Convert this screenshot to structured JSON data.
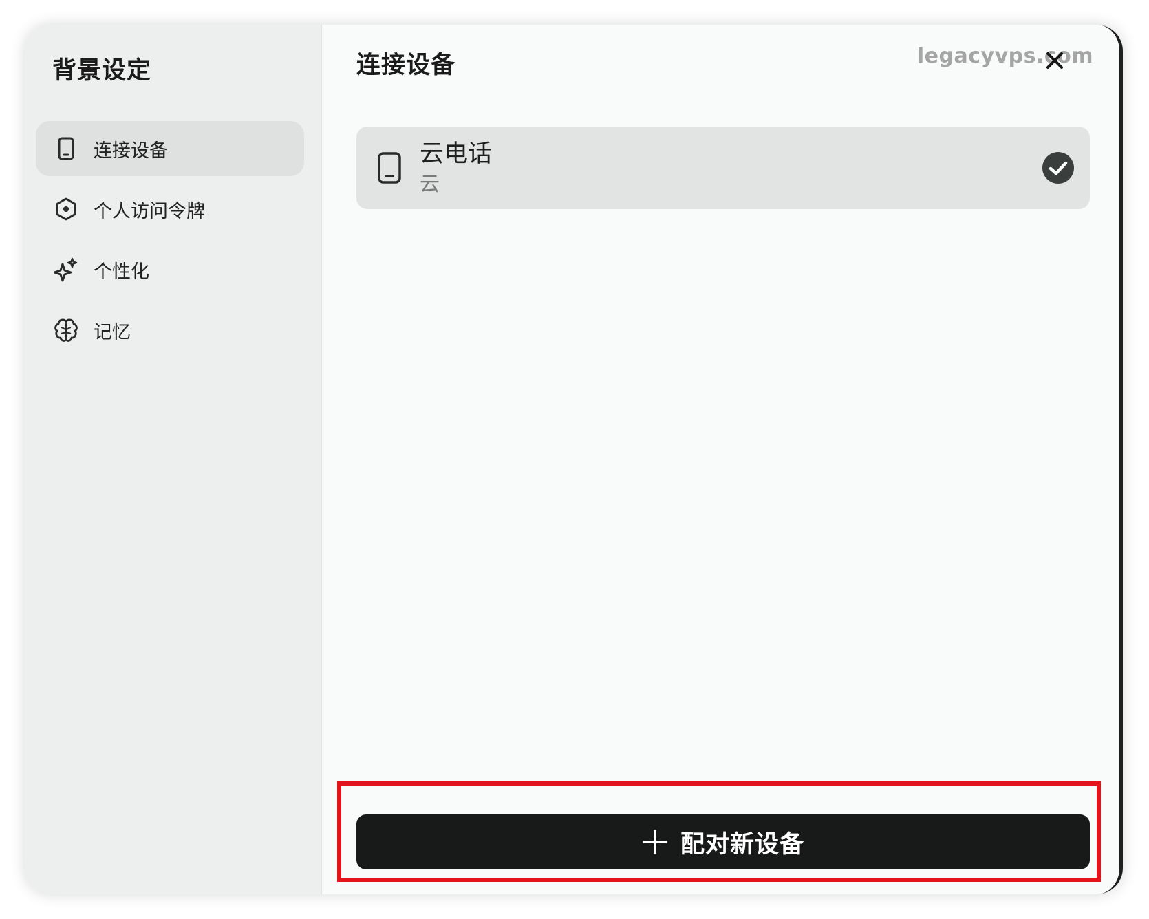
{
  "sidebar": {
    "title": "背景设定",
    "items": [
      {
        "label": "连接设备",
        "icon": "phone-icon",
        "active": true
      },
      {
        "label": "个人访问令牌",
        "icon": "hexagon-token-icon",
        "active": false
      },
      {
        "label": "个性化",
        "icon": "sparkle-icon",
        "active": false
      },
      {
        "label": "记忆",
        "icon": "brain-icon",
        "active": false
      }
    ]
  },
  "main": {
    "title": "连接设备",
    "watermark": "legacyvps.com",
    "close_icon": "close-icon",
    "devices": [
      {
        "name": "云电话",
        "subtitle": "云",
        "icon": "phone-icon",
        "selected": true
      }
    ],
    "pair_button": {
      "label": "配对新设备",
      "icon": "plus-icon"
    }
  },
  "colors": {
    "sidebar_bg": "#edeeee",
    "main_bg": "#f9fafa",
    "active_item_bg": "#dfe0e0",
    "card_bg": "#e2e3e3",
    "button_bg": "#181a19",
    "check_bg": "#3a3f3d",
    "highlight": "#e3151b",
    "watermark": "#a5a5a5"
  }
}
